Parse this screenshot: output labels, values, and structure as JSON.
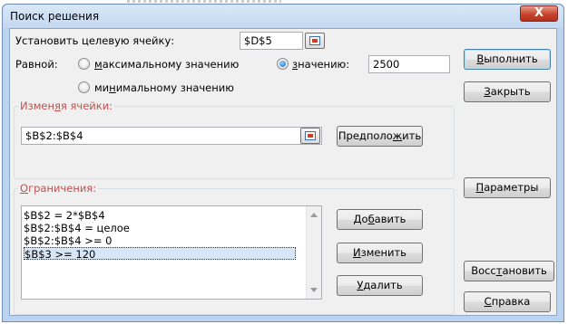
{
  "window": {
    "title": "Поиск решения",
    "close_glyph": "X"
  },
  "target": {
    "label": "Установить целевую ячейку:",
    "value": "$D$5"
  },
  "equal": {
    "label": "Равной:",
    "max": {
      "pre": "",
      "accel": "м",
      "post": "аксимальному значению",
      "selected": false
    },
    "value_opt": {
      "pre": "",
      "accel": "з",
      "post": "начению:",
      "selected": true,
      "value": "2500"
    },
    "min": {
      "pre": "ми",
      "accel": "н",
      "post": "имальному значению",
      "selected": false
    }
  },
  "changing": {
    "label_pre": "Измен",
    "label_accel": "я",
    "label_post": "я ячейки:",
    "value": "$B$2:$B$4",
    "guess": {
      "pre": "Предполо",
      "accel": "ж",
      "post": "ить"
    }
  },
  "constraints": {
    "label_pre": "",
    "label_accel": "О",
    "label_post": "граничения:",
    "items": [
      "$B$2 = 2*$B$4",
      "$B$2:$B$4 = целое",
      "$B$2:$B$4 >= 0",
      "$B$3 >= 120"
    ],
    "selected_index": 3,
    "add": {
      "pre": "До",
      "accel": "б",
      "post": "авить"
    },
    "change": {
      "pre": "",
      "accel": "И",
      "post": "зменить"
    },
    "delete": {
      "pre": "",
      "accel": "У",
      "post": "далить"
    }
  },
  "buttons": {
    "solve": {
      "pre": "",
      "accel": "В",
      "post": "ыполнить"
    },
    "close": {
      "pre": "",
      "accel": "З",
      "post": "акрыть"
    },
    "options": {
      "pre": "",
      "accel": "П",
      "post": "араметры"
    },
    "reset": {
      "pre": "Восс",
      "accel": "т",
      "post": "ановить"
    },
    "help": {
      "pre": "",
      "accel": "С",
      "post": "правка"
    }
  }
}
